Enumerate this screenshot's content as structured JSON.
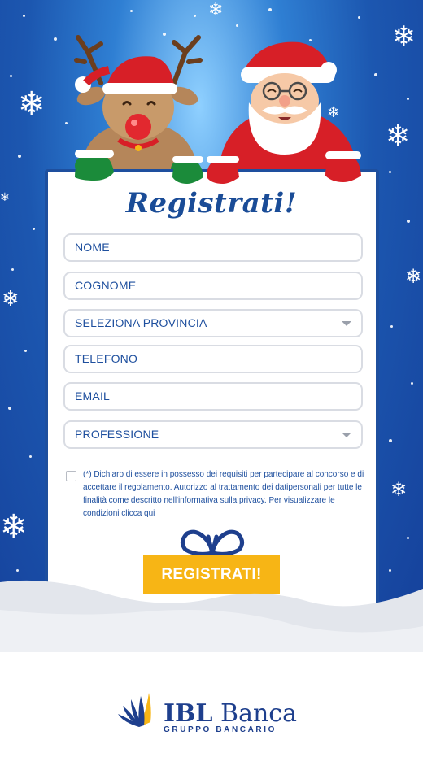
{
  "form": {
    "title": "Registrati!",
    "fields": [
      {
        "placeholder": "NOME"
      },
      {
        "placeholder": "COGNOME"
      },
      {
        "placeholder": "SELEZIONA PROVINCIA"
      },
      {
        "placeholder": "TELEFONO"
      },
      {
        "placeholder": "EMAIL"
      },
      {
        "placeholder": "PROFESSIONE"
      }
    ],
    "consent_text": "(*) Dichiaro di essere in possesso dei requisiti per partecipare al concorso e di accettare il regolamento. Autorizzo al trattamento dei datipersonali per tutte le finalità come descritto nell'informativa sulla privacy. Per visualizzare le condizioni clicca qui",
    "submit_label": "REGISTRATI!"
  },
  "footer": {
    "brand_bold": "IBL",
    "brand_rest": "Banca",
    "brand_sub": "GRUPPO BANCARIO"
  },
  "colors": {
    "primary_blue": "#1e4f9e",
    "button_yellow": "#f7b515",
    "background_blue": "#1c57b0"
  },
  "icons": [
    "reindeer",
    "santa-claus",
    "snowflake",
    "gift-bow",
    "chevron-down",
    "ibl-banca-logo"
  ]
}
